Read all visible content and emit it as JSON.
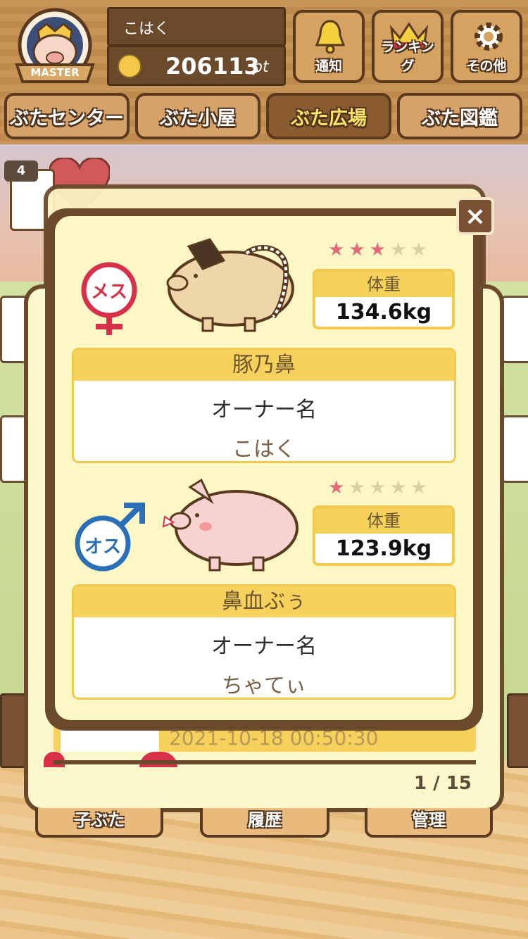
{
  "header": {
    "badge_text": "MASTER",
    "user_name": "こはく",
    "points_value": "206113",
    "points_unit": "pt",
    "buttons": [
      {
        "label": "通知",
        "icon": "bell-icon"
      },
      {
        "label": "ランキング",
        "icon": "crown-icon"
      },
      {
        "label": "その他",
        "icon": "gear-icon"
      }
    ]
  },
  "tabs": [
    {
      "label": "ぶたセンター",
      "active": false
    },
    {
      "label": "ぶた小屋",
      "active": false
    },
    {
      "label": "ぶた広場",
      "active": true
    },
    {
      "label": "ぶた図鑑",
      "active": false
    }
  ],
  "background": {
    "notification_count": "4",
    "history_date": "2021-10-18 00:50:30",
    "page_indicator": "1 / 15",
    "bottom_buttons": [
      "子ぶた",
      "履歴",
      "管理"
    ]
  },
  "modal": {
    "close_label": "×",
    "pigs": [
      {
        "gender_label": "メス",
        "gender": "female",
        "stars_filled": 3,
        "stars_total": 5,
        "weight_label": "体重",
        "weight": "134.6kg",
        "pig_name": "豚乃鼻",
        "owner_label": "オーナー名",
        "owner_name": "こはく"
      },
      {
        "gender_label": "オス",
        "gender": "male",
        "stars_filled": 1,
        "stars_total": 5,
        "weight_label": "体重",
        "weight": "123.9kg",
        "pig_name": "鼻血ぶぅ",
        "owner_label": "オーナー名",
        "owner_name": "ちゃてぃ"
      }
    ]
  },
  "colors": {
    "female": "#d9304a",
    "male": "#2a6fb8",
    "star_on": "#e26a78",
    "star_off": "#d8cfa4",
    "accent_yellow": "#f6d15b",
    "wood_dark": "#6b4a2c"
  }
}
